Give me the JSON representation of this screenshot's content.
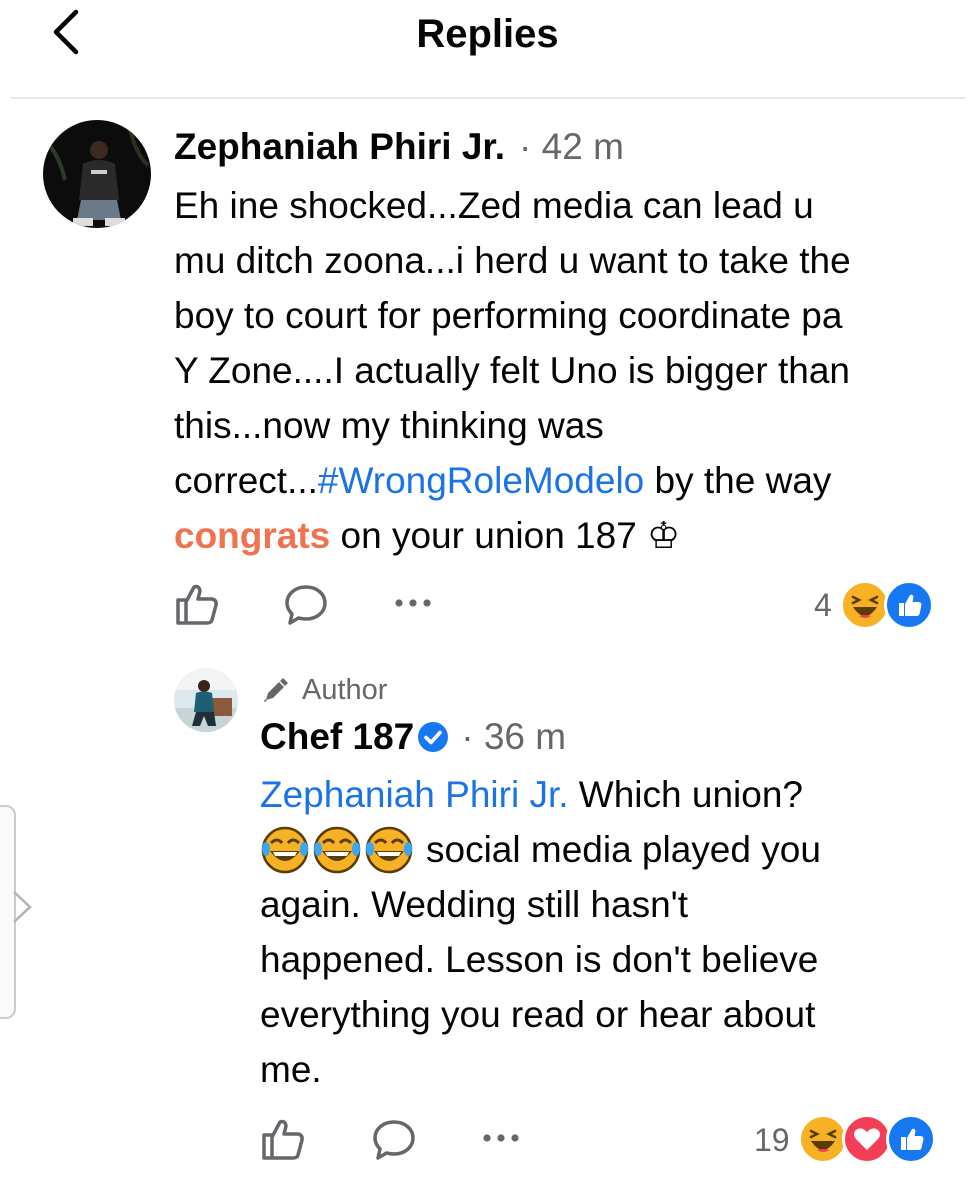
{
  "header": {
    "title": "Replies"
  },
  "comment": {
    "author": "Zephaniah Phiri Jr.",
    "time": "· 42 m",
    "lines": [
      "Eh ine shocked...Zed media can lead u",
      "mu ditch zoona...i herd u want to take the",
      "boy to court for performing coordinate pa",
      "Y Zone....I actually felt Uno is bigger than",
      "this...now my thinking was"
    ],
    "line6_start": "correct...",
    "hashtag": "#WrongRoleModelo",
    "line6_end": " by the way",
    "congrats": "congrats",
    "line7_end": " on your union 187 ♔",
    "reaction_count": "4",
    "reactions": [
      "laughing-face-icon",
      "like-icon"
    ]
  },
  "reply": {
    "badge": "Author",
    "author": "Chef 187",
    "verified": true,
    "time": "· 36 m",
    "mention": "Zephaniah Phiri Jr.",
    "line1_end": " Which union?",
    "line2_text": "social media played you",
    "lines": [
      "again. Wedding still hasn't",
      "happened. Lesson is don't believe",
      "everything you read or hear about",
      "me."
    ],
    "reaction_count": "19",
    "reactions": [
      "laughing-face-icon",
      "heart-icon",
      "like-icon"
    ]
  },
  "colors": {
    "link": "#1a73e8",
    "congrats": "#f07350",
    "meta": "#65676b",
    "like_blue": "#1877f2",
    "love_red": "#f33e58",
    "haha_yellow": "#f7b125"
  }
}
